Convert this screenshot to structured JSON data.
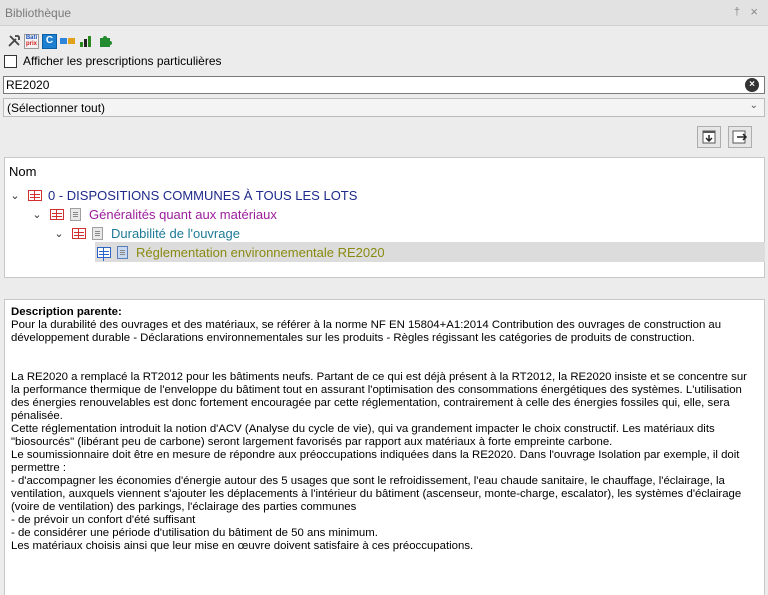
{
  "window": {
    "title": "Bibliothèque",
    "pin_glyph": "†",
    "close_glyph": "×"
  },
  "toolbar": {
    "icons": [
      "tools-icon",
      "bati-prix-icon",
      "c-icon",
      "flag-icon",
      "chart-icon",
      "puzzle-icon"
    ],
    "bati_label_top": "Bati",
    "bati_label_bottom": "prix",
    "c_label": "C"
  },
  "options": {
    "show_particular_label": "Afficher les prescriptions particulières",
    "checked": false
  },
  "search": {
    "value": "RE2020",
    "clear_glyph": "×"
  },
  "filter_select": {
    "selected": "(Sélectionner tout)"
  },
  "actions": [
    "export-button",
    "import-button"
  ],
  "tree": {
    "column_header": "Nom",
    "nodes": [
      {
        "label": "0 - DISPOSITIONS COMMUNES À TOUS LES LOTS",
        "color": "#1f2a8a"
      },
      {
        "label": "Généralités quant aux matériaux",
        "color": "#9b1e9b"
      },
      {
        "label": "Durabilité de l'ouvrage",
        "color": "#1e7a96"
      },
      {
        "label": "Réglementation environnementale RE2020",
        "color": "#8a8a12",
        "selected": true
      }
    ]
  },
  "description": {
    "title": "Description parente:",
    "para1": "Pour la durabilité des ouvrages et des matériaux, se référer à la norme NF EN 15804+A1:2014 Contribution des ouvrages de construction au développement durable - Déclarations environnementales sur les produits - Règles régissant les catégories de produits de construction.",
    "para2": "La RE2020 a remplacé la RT2012 pour les bâtiments neufs. Partant de ce qui est déjà présent à la RT2012, la RE2020 insiste et se concentre sur la performance thermique de l'enveloppe du bâtiment tout en assurant l'optimisation des consommations énergétiques des systèmes. L'utilisation des énergies renouvelables est donc fortement encouragée par cette réglementation, contrairement à celle des énergies fossiles qui, elle, sera pénalisée.",
    "para3": "Cette réglementation introduit la notion d'ACV (Analyse du cycle de vie), qui va grandement impacter le choix constructif. Les matériaux dits \"biosourcés\" (libérant peu de carbone) seront largement favorisés par rapport aux matériaux à forte empreinte carbone.",
    "para4": "Le soumissionnaire doit être en mesure de répondre aux préoccupations indiquées dans la RE2020. Dans l'ouvrage Isolation par exemple, il doit permettre :",
    "para5": "- d'accompagner les économies d'énergie autour des 5 usages que sont le refroidissement, l'eau chaude sanitaire, le chauffage, l'éclairage, la ventilation, auxquels viennent s'ajouter les déplacements à l'intérieur du bâtiment (ascenseur, monte-charge, escalator), les systèmes d'éclairage (voire de ventilation) des parkings, l'éclairage des parties communes",
    "para6": "- de prévoir un confort d'été suffisant",
    "para7": "- de considérer une période d'utilisation du bâtiment de 50 ans minimum.",
    "para8": "Les matériaux choisis ainsi que leur mise en œuvre doivent satisfaire à ces préoccupations."
  }
}
